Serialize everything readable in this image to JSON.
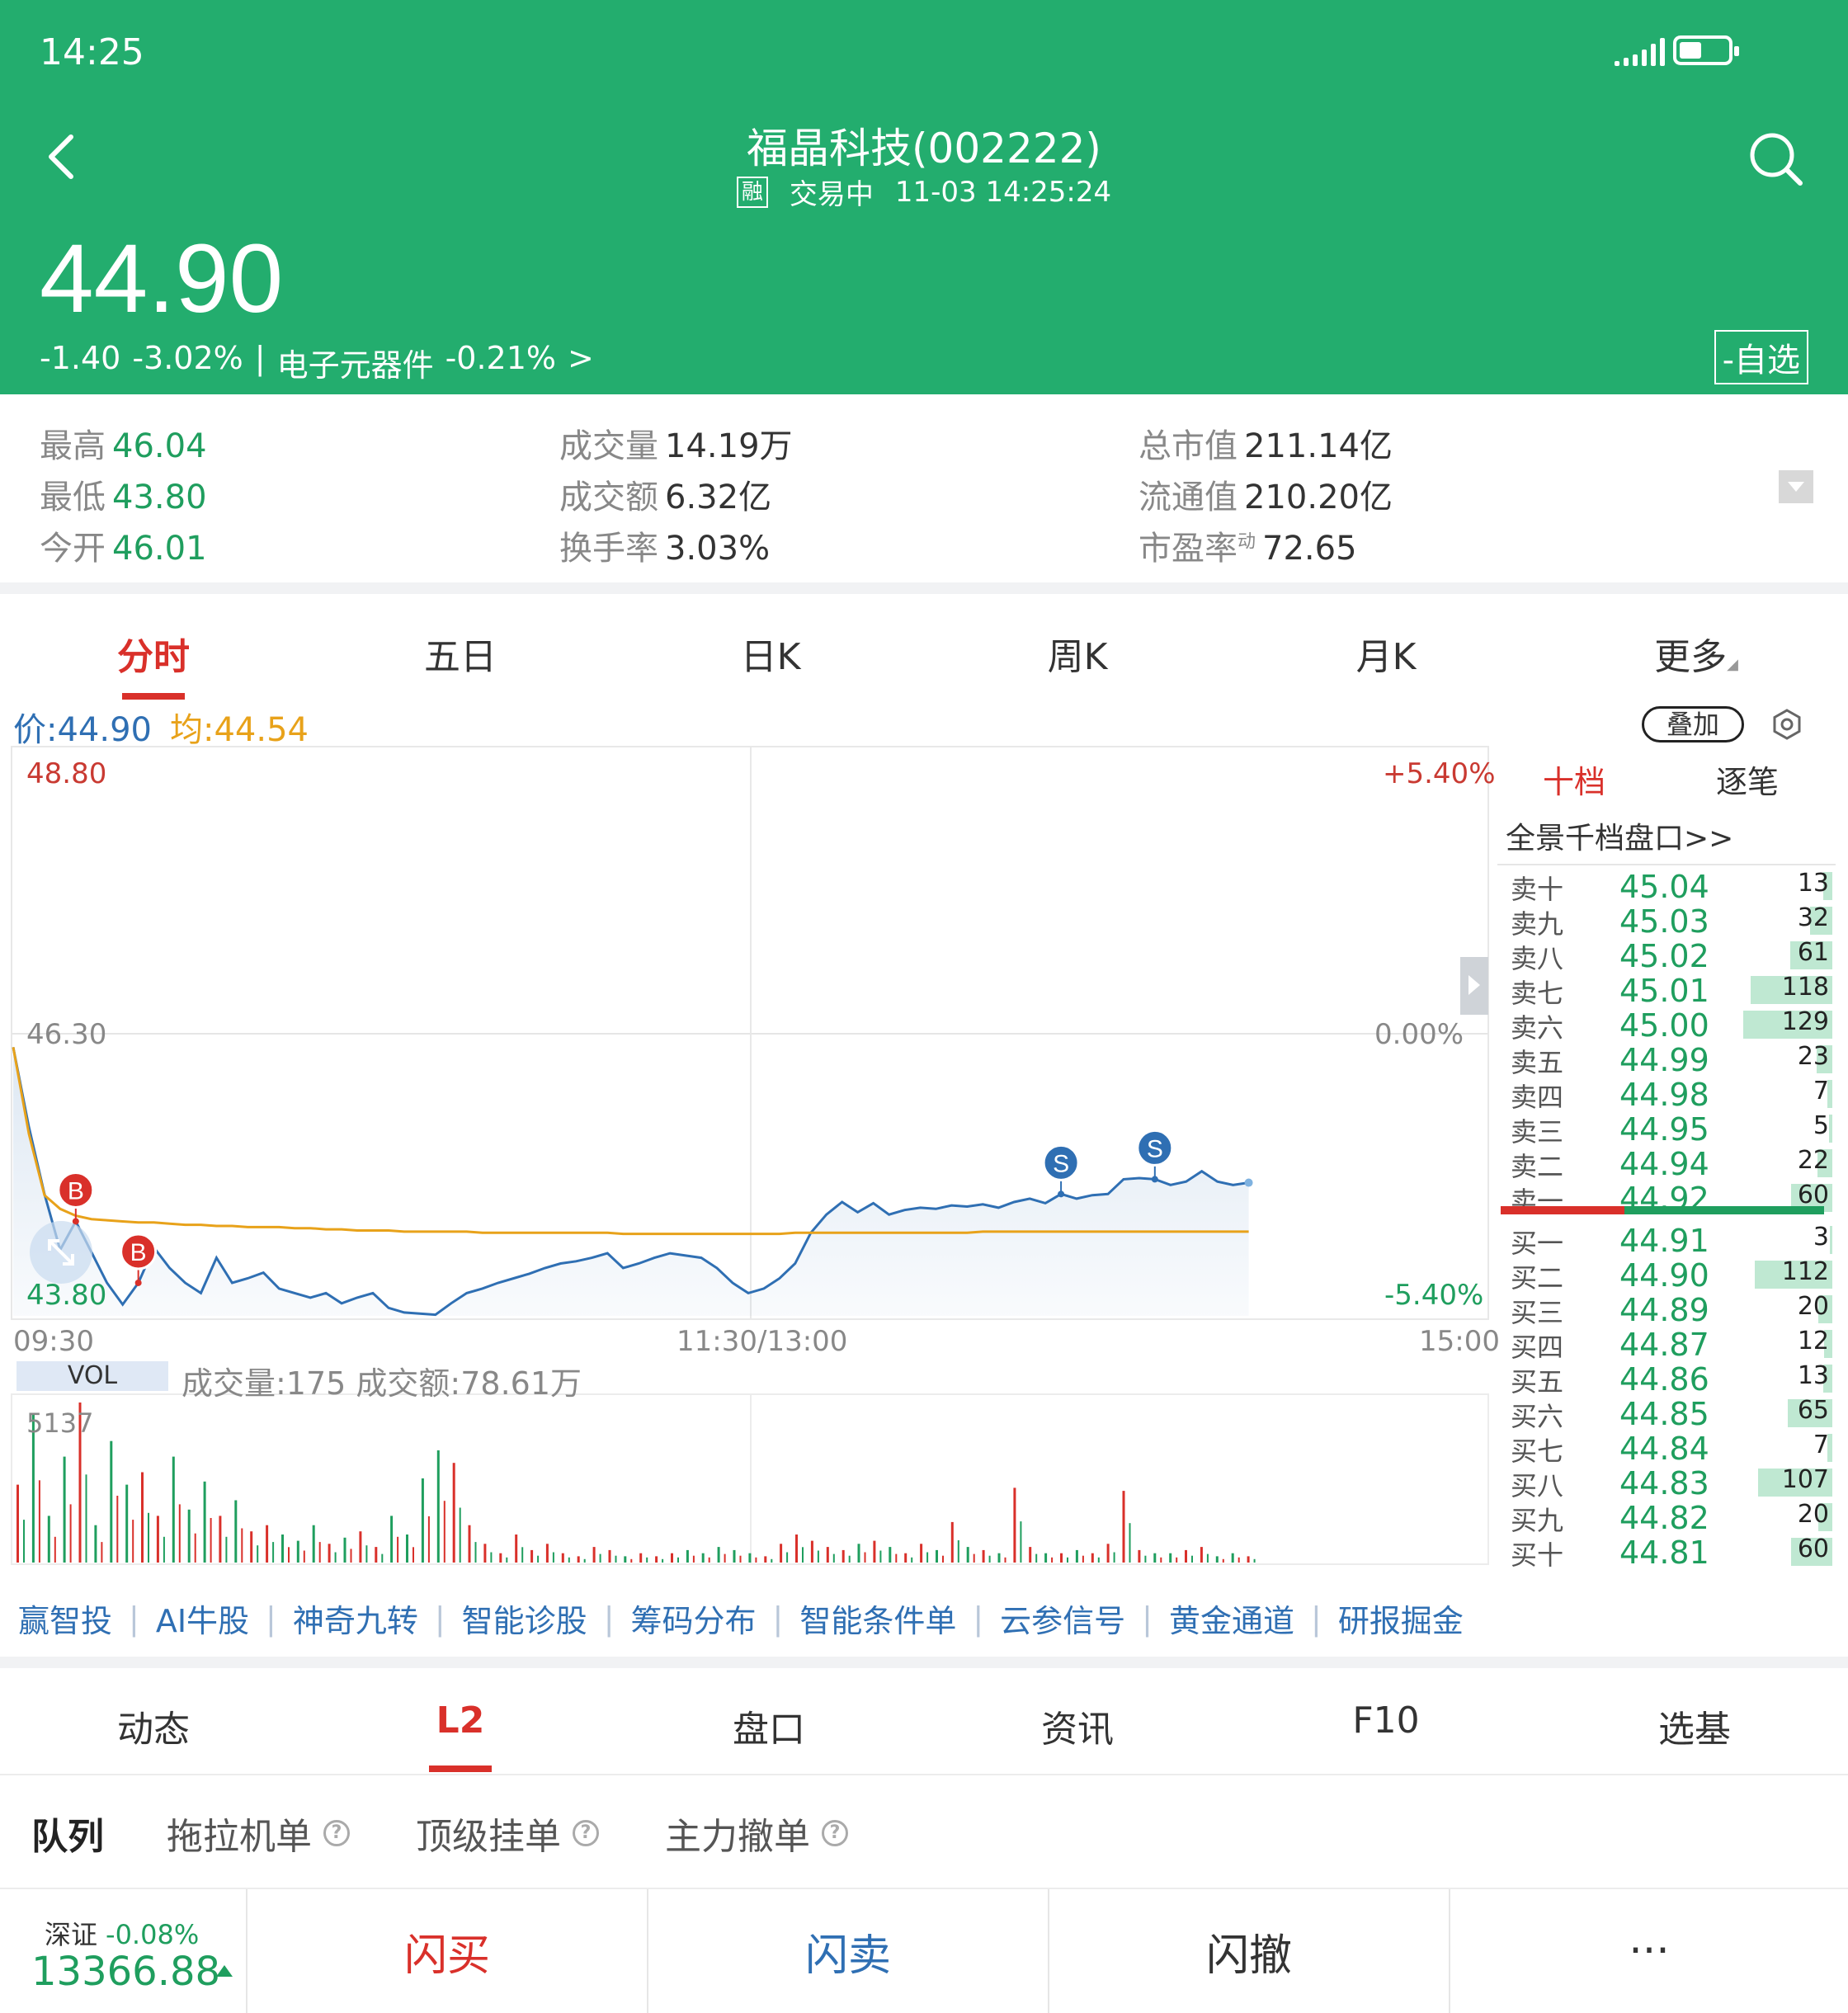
{
  "status": {
    "time": "14:25"
  },
  "header": {
    "title": "福晶科技(002222)",
    "margin_tag": "融",
    "trade_status": "交易中",
    "datetime": "11-03 14:25:24",
    "price": "44.90",
    "change": "-1.40",
    "change_pct": "-3.02%",
    "sector_sep": "|",
    "sector": "电子元器件",
    "sector_pct": "-0.21%",
    "sector_arrow": ">",
    "watch_label": "-自选",
    "bg_color": "#23ad6e"
  },
  "stats": {
    "high": {
      "label": "最高",
      "value": "46.04"
    },
    "low": {
      "label": "最低",
      "value": "43.80"
    },
    "open": {
      "label": "今开",
      "value": "46.01"
    },
    "volume": {
      "label": "成交量",
      "value": "14.19万"
    },
    "amount": {
      "label": "成交额",
      "value": "6.32亿"
    },
    "turnover": {
      "label": "换手率",
      "value": "3.03%"
    },
    "mktcap": {
      "label": "总市值",
      "value": "211.14亿"
    },
    "float_cap": {
      "label": "流通值",
      "value": "210.20亿"
    },
    "pe": {
      "label": "市盈率",
      "sup": "动",
      "value": "72.65"
    }
  },
  "chart_tabs": [
    {
      "label": "分时",
      "active": true
    },
    {
      "label": "五日"
    },
    {
      "label": "日K"
    },
    {
      "label": "周K"
    },
    {
      "label": "月K"
    },
    {
      "label": "更多"
    }
  ],
  "legend": {
    "price": "价:44.90",
    "avg": "均:44.54",
    "overlay": "叠加"
  },
  "axes": {
    "y_top": "48.80",
    "y_mid": "46.30",
    "y_bot": "43.80",
    "pct_top": "+5.40%",
    "pct_mid": "0.00%",
    "pct_bot": "-5.40%",
    "t_start": "09:30",
    "t_mid": "11:30/13:00",
    "t_end": "15:00"
  },
  "volume": {
    "label": "VOL",
    "info": "成交量:175  成交额:78.61万",
    "max": "5137"
  },
  "chart_data": {
    "type": "line",
    "title": "",
    "ylim": [
      43.8,
      48.8
    ],
    "reference_close": 46.3,
    "x_range": [
      "09:30",
      "15:00"
    ],
    "series": [
      {
        "name": "价",
        "color": "#2f6fb3",
        "values": [
          46.16,
          45.46,
          44.87,
          44.38,
          44.63,
          44.36,
          44.09,
          43.9,
          44.09,
          44.4,
          44.22,
          44.09,
          44.0,
          44.31,
          44.09,
          44.13,
          44.18,
          44.04,
          44.0,
          43.96,
          44.0,
          43.91,
          43.96,
          44.0,
          43.87,
          43.83,
          43.82,
          43.81,
          43.91,
          44.0,
          44.04,
          44.09,
          44.13,
          44.17,
          44.22,
          44.26,
          44.28,
          44.31,
          44.35,
          44.22,
          44.26,
          44.31,
          44.35,
          44.33,
          44.31,
          44.22,
          44.09,
          44.0,
          44.04,
          44.13,
          44.26,
          44.53,
          44.69,
          44.8,
          44.71,
          44.79,
          44.69,
          44.73,
          44.75,
          44.74,
          44.77,
          44.76,
          44.78,
          44.75,
          44.8,
          44.83,
          44.79,
          44.87,
          44.83,
          44.86,
          44.87,
          45.0,
          45.01,
          45.0,
          44.95,
          44.98,
          45.07,
          44.98,
          44.95,
          44.97
        ]
      },
      {
        "name": "均",
        "color": "#e8a21a",
        "values": [
          46.16,
          45.4,
          44.86,
          44.74,
          44.68,
          44.65,
          44.64,
          44.63,
          44.62,
          44.62,
          44.61,
          44.6,
          44.6,
          44.59,
          44.59,
          44.58,
          44.58,
          44.58,
          44.57,
          44.57,
          44.56,
          44.56,
          44.55,
          44.55,
          44.55,
          44.54,
          44.54,
          44.54,
          44.54,
          44.54,
          44.53,
          44.53,
          44.53,
          44.53,
          44.53,
          44.53,
          44.53,
          44.53,
          44.53,
          44.52,
          44.52,
          44.52,
          44.52,
          44.52,
          44.52,
          44.52,
          44.52,
          44.52,
          44.52,
          44.52,
          44.53,
          44.53,
          44.53,
          44.53,
          44.53,
          44.53,
          44.53,
          44.53,
          44.53,
          44.53,
          44.53,
          44.53,
          44.54,
          44.54,
          44.54,
          44.54,
          44.54,
          44.54,
          44.54,
          44.54,
          44.54,
          44.54,
          44.54,
          44.54,
          44.54,
          44.54,
          44.54,
          44.54,
          44.54,
          44.54
        ]
      }
    ],
    "trade_marks": [
      {
        "label": "B",
        "index": 4,
        "color": "#d9302a"
      },
      {
        "label": "B",
        "index": 8,
        "color": "#d9302a"
      },
      {
        "label": "S",
        "index": 67,
        "color": "#2f6fb3"
      },
      {
        "label": "S",
        "index": 73,
        "color": "#2f6fb3"
      }
    ],
    "volume_max": 5137,
    "volume_values": [
      2500,
      4800,
      1500,
      3400,
      5137,
      1200,
      3900,
      2500,
      2900,
      1500,
      3400,
      1700,
      2600,
      1500,
      2000,
      1000,
      1200,
      900,
      700,
      1200,
      600,
      800,
      1000,
      500,
      1500,
      900,
      2700,
      3600,
      3200,
      1200,
      600,
      300,
      900,
      400,
      600,
      300,
      200,
      500,
      400,
      200,
      300,
      200,
      300,
      400,
      300,
      500,
      400,
      300,
      200,
      600,
      900,
      700,
      500,
      400,
      600,
      700,
      500,
      300,
      600,
      400,
      1300,
      500,
      400,
      300,
      2400,
      500,
      300,
      300,
      400,
      300,
      600,
      2300,
      400,
      300,
      300,
      400,
      500,
      200,
      300,
      200
    ]
  },
  "orderbook": {
    "tab1": "十档",
    "tab2": "逐笔",
    "link": "全景千档盘口>>",
    "asks": [
      {
        "name": "卖十",
        "price": "45.04",
        "vol": "13"
      },
      {
        "name": "卖九",
        "price": "45.03",
        "vol": "32"
      },
      {
        "name": "卖八",
        "price": "45.02",
        "vol": "61"
      },
      {
        "name": "卖七",
        "price": "45.01",
        "vol": "118"
      },
      {
        "name": "卖六",
        "price": "45.00",
        "vol": "129"
      },
      {
        "name": "卖五",
        "price": "44.99",
        "vol": "23"
      },
      {
        "name": "卖四",
        "price": "44.98",
        "vol": "7"
      },
      {
        "name": "卖三",
        "price": "44.95",
        "vol": "5"
      },
      {
        "name": "卖二",
        "price": "44.94",
        "vol": "22"
      },
      {
        "name": "卖一",
        "price": "44.92",
        "vol": "60"
      }
    ],
    "bids": [
      {
        "name": "买一",
        "price": "44.91",
        "vol": "3"
      },
      {
        "name": "买二",
        "price": "44.90",
        "vol": "112"
      },
      {
        "name": "买三",
        "price": "44.89",
        "vol": "20"
      },
      {
        "name": "买四",
        "price": "44.87",
        "vol": "12"
      },
      {
        "name": "买五",
        "price": "44.86",
        "vol": "13"
      },
      {
        "name": "买六",
        "price": "44.85",
        "vol": "65"
      },
      {
        "name": "买七",
        "price": "44.84",
        "vol": "7"
      },
      {
        "name": "买八",
        "price": "44.83",
        "vol": "107"
      },
      {
        "name": "买九",
        "price": "44.82",
        "vol": "20"
      },
      {
        "name": "买十",
        "price": "44.81",
        "vol": "60"
      }
    ]
  },
  "features": [
    "赢智投",
    "AI牛股",
    "神奇九转",
    "智能诊股",
    "筹码分布",
    "智能条件单",
    "云参信号",
    "黄金通道",
    "研报掘金"
  ],
  "main_tabs": [
    {
      "label": "动态"
    },
    {
      "label": "L2",
      "active": true
    },
    {
      "label": "盘口"
    },
    {
      "label": "资讯"
    },
    {
      "label": "F10"
    },
    {
      "label": "选基"
    }
  ],
  "sub_tabs": [
    {
      "label": "队列",
      "active": true
    },
    {
      "label": "拖拉机单",
      "help": "?"
    },
    {
      "label": "顶级挂单",
      "help": "?"
    },
    {
      "label": "主力撤单",
      "help": "?"
    }
  ],
  "bottom": {
    "index_name": "深证",
    "index_change": "-0.08%",
    "index_value": "13366.88",
    "buy": "闪买",
    "sell": "闪卖",
    "cancel": "闪撤",
    "more": "···",
    "colors": {
      "buy": "#d9302a",
      "sell": "#2f6fb3",
      "cancel": "#333333"
    }
  }
}
